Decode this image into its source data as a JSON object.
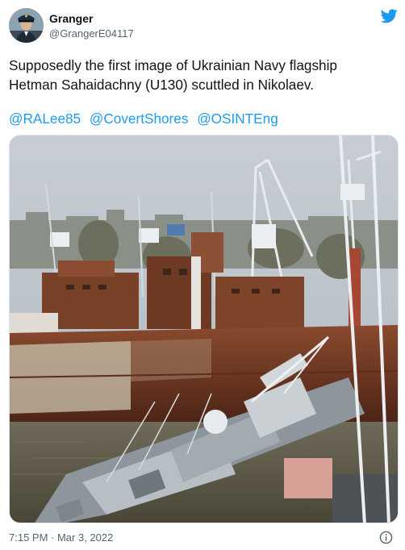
{
  "author": {
    "display_name": "Granger",
    "handle": "@GrangerE04117"
  },
  "icons": {
    "brand": "twitter-bird-icon",
    "info": "info-icon"
  },
  "colors": {
    "link": "#1d9bf0",
    "text": "#0f1419",
    "secondary": "#536471",
    "twitter_blue": "#1d9bf0"
  },
  "tweet": {
    "text_lines": [
      "Supposedly the first image of Ukrainian Navy flagship",
      "Hetman Sahaidachny (U130) scuttled in Nikolaev."
    ],
    "mentions": [
      "@RALee85",
      "@CovertShores",
      "@OSINTEng"
    ],
    "timestamp": "7:15 PM · Mar 3, 2022"
  }
}
